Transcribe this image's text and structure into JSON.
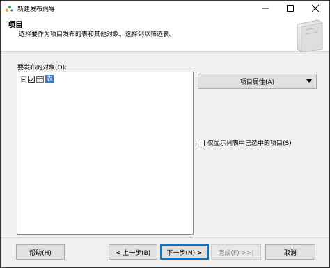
{
  "window": {
    "title": "新建发布向导"
  },
  "header": {
    "title": "项目",
    "subtitle": "选择要作为项目发布的表和其他对象。选择列以筛选表。"
  },
  "objects": {
    "label": "要发布的对象(O):",
    "tree": [
      {
        "label": "表",
        "checked": true,
        "expanded": false,
        "selected": true
      }
    ]
  },
  "properties": {
    "button_label": "项目属性(A)"
  },
  "filter": {
    "only_show_checked_label": "仅显示列表中已选中的项目(S)",
    "checked": false
  },
  "footer": {
    "help": "帮助(H)",
    "back": "< 上一步(B)",
    "next": "下一步(N) >",
    "finish": "完成(F) >>|",
    "cancel": "取消"
  },
  "colors": {
    "selection": "#3c78c8",
    "default_button_border": "#0078d7",
    "disabled_text": "#8c8c8c"
  }
}
